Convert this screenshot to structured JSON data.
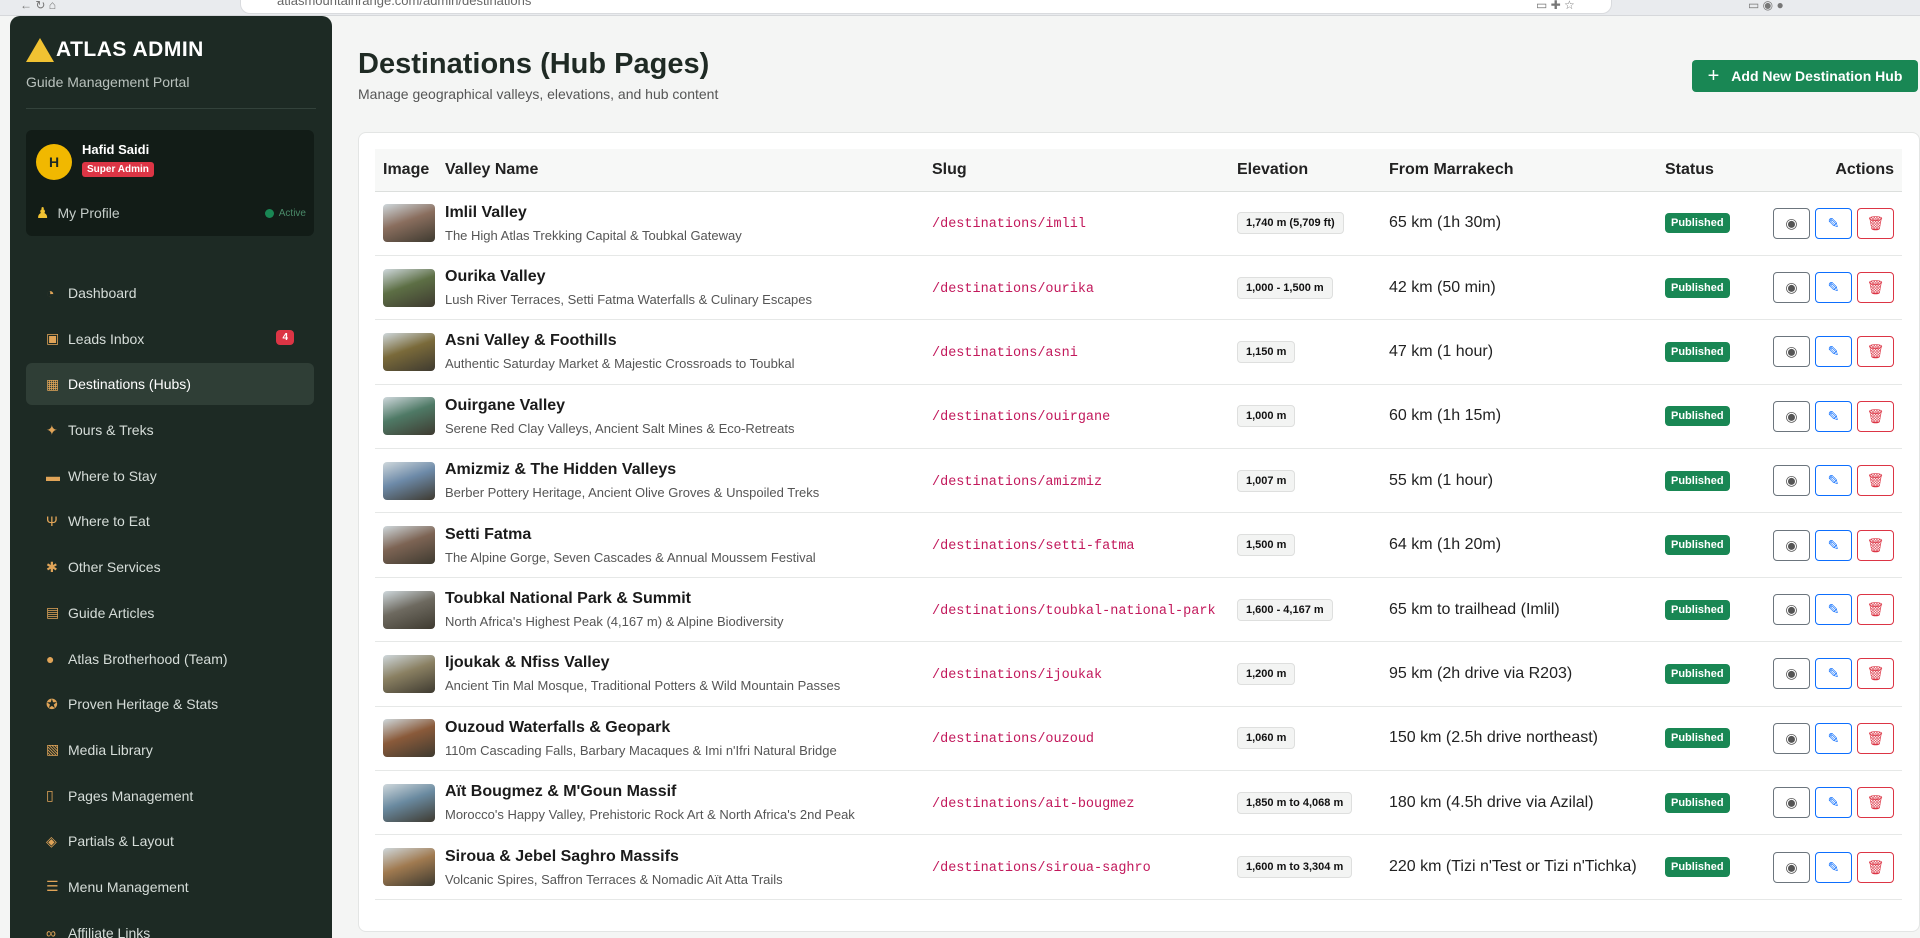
{
  "browser": {
    "url": "atlasmountainrange.com/admin/destinations"
  },
  "sidebar": {
    "brand_title": "ATLAS ADMIN",
    "brand_subtitle": "Guide Management Portal",
    "profile": {
      "initial": "H",
      "name": "Hafid Saidi",
      "role": "Super Admin",
      "link_label": "My Profile",
      "status": "Active"
    },
    "items": [
      {
        "label": "Dashboard",
        "icon": "dashboard-icon",
        "glyph": "◔"
      },
      {
        "label": "Leads Inbox",
        "icon": "inbox-icon",
        "glyph": "▣",
        "badge": "4"
      },
      {
        "label": "Destinations (Hubs)",
        "icon": "map-icon",
        "glyph": "▦",
        "active": true
      },
      {
        "label": "Tours & Treks",
        "icon": "hiker-icon",
        "glyph": "✦"
      },
      {
        "label": "Where to Stay",
        "icon": "bed-icon",
        "glyph": "▬"
      },
      {
        "label": "Where to Eat",
        "icon": "utensils-icon",
        "glyph": "Ψ"
      },
      {
        "label": "Other Services",
        "icon": "gears-icon",
        "glyph": "✱"
      },
      {
        "label": "Guide Articles",
        "icon": "book-icon",
        "glyph": "▤"
      },
      {
        "label": "Atlas Brotherhood (Team)",
        "icon": "users-icon",
        "glyph": "●"
      },
      {
        "label": "Proven Heritage & Stats",
        "icon": "award-icon",
        "glyph": "✪"
      },
      {
        "label": "Media Library",
        "icon": "images-icon",
        "glyph": "▧"
      },
      {
        "label": "Pages Management",
        "icon": "file-icon",
        "glyph": "▯"
      },
      {
        "label": "Partials & Layout",
        "icon": "cubes-icon",
        "glyph": "◈"
      },
      {
        "label": "Menu Management",
        "icon": "bars-icon",
        "glyph": "☰"
      },
      {
        "label": "Affiliate Links",
        "icon": "link-icon",
        "glyph": "∞"
      }
    ]
  },
  "header": {
    "title": "Destinations (Hub Pages)",
    "subtitle": "Manage geographical valleys, elevations, and hub content",
    "add_button": "Add New Destination Hub"
  },
  "table": {
    "columns": [
      "Image",
      "Valley Name",
      "Slug",
      "Elevation",
      "From Marrakech",
      "Status",
      "Actions"
    ],
    "rows": [
      {
        "name": "Imlil Valley",
        "desc": "The High Atlas Trekking Capital & Toubkal Gateway",
        "slug": "/destinations/imlil",
        "elevation": "1,740 m (5,709 ft)",
        "from": "65 km (1h 30m)",
        "status": "Published",
        "thumb": "#8a6e5e"
      },
      {
        "name": "Ourika Valley",
        "desc": "Lush River Terraces, Setti Fatma Waterfalls & Culinary Escapes",
        "slug": "/destinations/ourika",
        "elevation": "1,000 - 1,500 m",
        "from": "42 km (50 min)",
        "status": "Published",
        "thumb": "#5d6f45"
      },
      {
        "name": "Asni Valley & Foothills",
        "desc": "Authentic Saturday Market & Majestic Crossroads to Toubkal",
        "slug": "/destinations/asni",
        "elevation": "1,150 m",
        "from": "47 km (1 hour)",
        "status": "Published",
        "thumb": "#7a6a3a"
      },
      {
        "name": "Ouirgane Valley",
        "desc": "Serene Red Clay Valleys, Ancient Salt Mines & Eco-Retreats",
        "slug": "/destinations/ouirgane",
        "elevation": "1,000 m",
        "from": "60 km (1h 15m)",
        "status": "Published",
        "thumb": "#4f7a66"
      },
      {
        "name": "Amizmiz & The Hidden Valleys",
        "desc": "Berber Pottery Heritage, Ancient Olive Groves & Unspoiled Treks",
        "slug": "/destinations/amizmiz",
        "elevation": "1,007 m",
        "from": "55 km (1 hour)",
        "status": "Published",
        "thumb": "#6d8aa8"
      },
      {
        "name": "Setti Fatma",
        "desc": "The Alpine Gorge, Seven Cascades & Annual Moussem Festival",
        "slug": "/destinations/setti-fatma",
        "elevation": "1,500 m",
        "from": "64 km (1h 20m)",
        "status": "Published",
        "thumb": "#7d6454"
      },
      {
        "name": "Toubkal National Park & Summit",
        "desc": "North Africa's Highest Peak (4,167 m) & Alpine Biodiversity",
        "slug": "/destinations/toubkal-national-park",
        "elevation": "1,600 - 4,167 m",
        "from": "65 km to trailhead (Imlil)",
        "status": "Published",
        "thumb": "#6e6a60"
      },
      {
        "name": "Ijoukak & Nfiss Valley",
        "desc": "Ancient Tin Mal Mosque, Traditional Potters & Wild Mountain Passes",
        "slug": "/destinations/ijoukak",
        "elevation": "1,200 m",
        "from": "95 km (2h drive via R203)",
        "status": "Published",
        "thumb": "#8a8062"
      },
      {
        "name": "Ouzoud Waterfalls & Geopark",
        "desc": "110m Cascading Falls, Barbary Macaques & Imi n'Ifri Natural Bridge",
        "slug": "/destinations/ouzoud",
        "elevation": "1,060 m",
        "from": "150 km (2.5h drive northeast)",
        "status": "Published",
        "thumb": "#8a5a3a"
      },
      {
        "name": "Aït Bougmez & M'Goun Massif",
        "desc": "Morocco's Happy Valley, Prehistoric Rock Art & North Africa's 2nd Peak",
        "slug": "/destinations/ait-bougmez",
        "elevation": "1,850 m to 4,068 m",
        "from": "180 km (4.5h drive via Azilal)",
        "status": "Published",
        "thumb": "#6a8aa0"
      },
      {
        "name": "Siroua & Jebel Saghro Massifs",
        "desc": "Volcanic Spires, Saffron Terraces & Nomadic Aït Atta Trails",
        "slug": "/destinations/siroua-saghro",
        "elevation": "1,600 m to 3,304 m",
        "from": "220 km (Tizi n'Test or Tizi n'Tichka)",
        "status": "Published",
        "thumb": "#a07a50"
      }
    ]
  },
  "colors": {
    "sidebar": "#1d2a24",
    "primary": "#198754",
    "danger": "#dc3545",
    "edit": "#0d6efd",
    "slug": "#c2185b"
  }
}
